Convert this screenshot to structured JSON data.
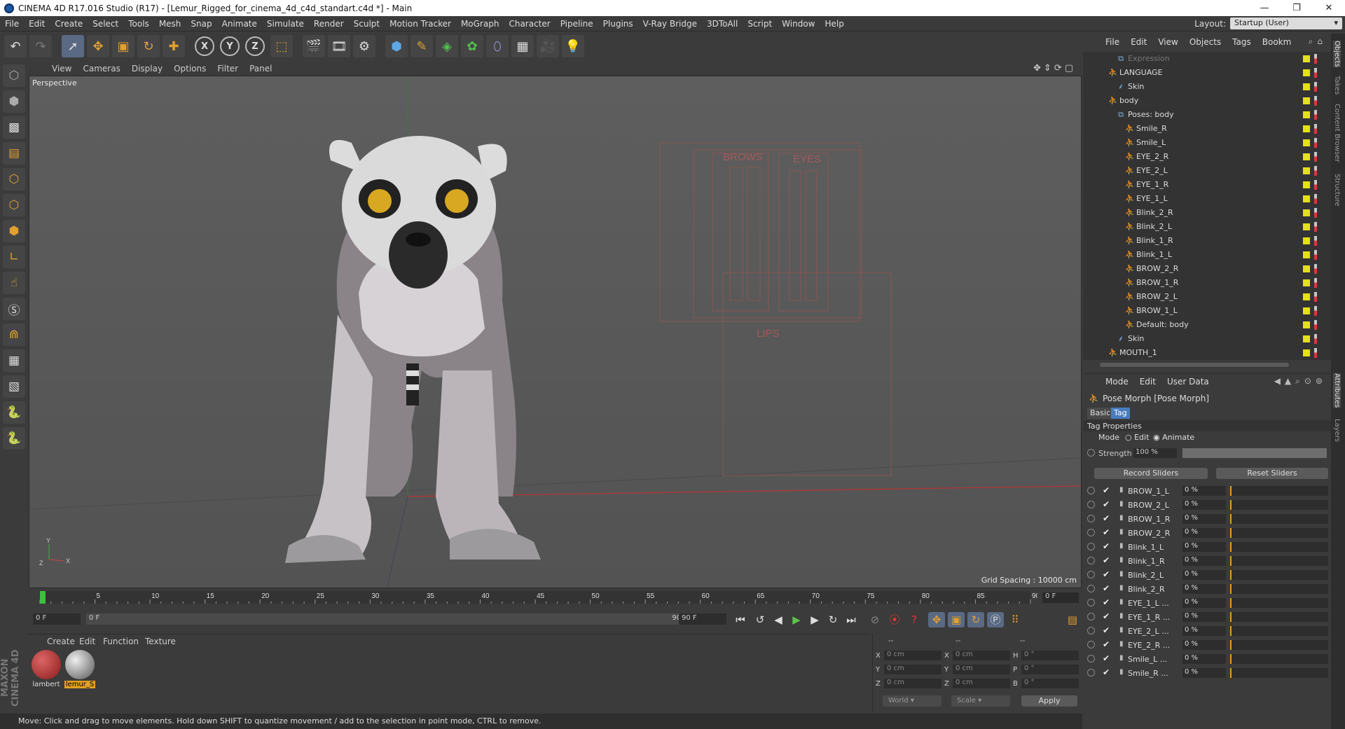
{
  "window": {
    "title": "CINEMA 4D R17.016 Studio (R17) - [Lemur_Rigged_for_cinema_4d_c4d_standart.c4d *] - Main",
    "controls": [
      "—",
      "❐",
      "✕"
    ]
  },
  "menubar": {
    "items": [
      "File",
      "Edit",
      "Create",
      "Select",
      "Tools",
      "Mesh",
      "Snap",
      "Animate",
      "Simulate",
      "Render",
      "Sculpt",
      "Motion Tracker",
      "MoGraph",
      "Character",
      "Pipeline",
      "Plugins",
      "V-Ray Bridge",
      "3DToAll",
      "Script",
      "Window",
      "Help"
    ],
    "layout_label": "Layout:",
    "layout_value": "Startup (User)"
  },
  "toolbar": {
    "icons": [
      "undo-icon",
      "redo-icon",
      "select-icon",
      "move-icon",
      "scale-icon",
      "rotate-icon",
      "add-icon",
      "x-axis-icon",
      "y-axis-icon",
      "z-axis-icon",
      "coordinate-system-icon",
      "render-view-icon",
      "render-picture-queue-icon",
      "render-settings-icon",
      "cube-icon",
      "pen-icon",
      "subdivision-icon",
      "cloner-icon",
      "deformer-icon",
      "floor-icon",
      "camera-icon",
      "light-icon"
    ],
    "axis_labels": [
      "X",
      "Y",
      "Z"
    ]
  },
  "lefttools": {
    "icons": [
      "make-editable-icon",
      "model-mode-icon",
      "texture-mode-icon",
      "workplane-icon",
      "points-mode-icon",
      "edges-mode-icon",
      "polygons-mode-icon",
      "axis-mode-icon",
      "tweak-mode-icon",
      "solo-icon",
      "snap-icon",
      "snap-grid-icon",
      "lock-workplane-icon",
      "python-icon",
      "python-script-icon"
    ],
    "brand": "MAXON CINEMA 4D"
  },
  "viewport": {
    "menu": [
      "View",
      "Cameras",
      "Display",
      "Options",
      "Filter",
      "Panel"
    ],
    "camera_label": "Perspective",
    "grid_spacing": "Grid Spacing : 10000 cm",
    "rig_labels": {
      "brows": "BROWS",
      "eyes": "EYES",
      "lips": "LIPS"
    },
    "axis": {
      "x": "X",
      "y": "Y",
      "z": "Z"
    }
  },
  "timeline": {
    "ticks": [
      "0",
      "5",
      "10",
      "15",
      "20",
      "25",
      "30",
      "35",
      "40",
      "45",
      "50",
      "55",
      "60",
      "65",
      "70",
      "75",
      "80",
      "85",
      "90"
    ],
    "current_frame": "0 F",
    "start_field": "0 F",
    "range_start": "0 F",
    "range_end": "90 F",
    "end_field": "90 F",
    "playhead_frame": 0,
    "max_frame": 90
  },
  "transport": {
    "buttons": [
      "go-to-start-icon",
      "previous-key-icon",
      "previous-frame-icon",
      "play-icon",
      "next-frame-icon",
      "next-key-icon",
      "go-to-end-icon",
      "autokey-icon",
      "record-icon",
      "keyframe-selection-icon",
      "move-key-icon",
      "scale-key-icon",
      "rotate-key-icon",
      "param-key-icon",
      "pla-key-icon",
      "timeline-icon"
    ]
  },
  "material_manager": {
    "menu": [
      "Create",
      "Edit",
      "Function",
      "Texture"
    ],
    "materials": [
      {
        "name": "lambert",
        "selected": false
      },
      {
        "name": "lemur_S",
        "selected": true
      }
    ]
  },
  "coordinates": {
    "header": [
      "--",
      "--",
      "--"
    ],
    "rows": [
      {
        "a": "X",
        "av": "0 cm",
        "b": "X",
        "bv": "0 cm",
        "c": "H",
        "cv": "0 °"
      },
      {
        "a": "Y",
        "av": "0 cm",
        "b": "Y",
        "bv": "0 cm",
        "c": "P",
        "cv": "0 °"
      },
      {
        "a": "Z",
        "av": "0 cm",
        "b": "Z",
        "bv": "0 cm",
        "c": "B",
        "cv": "0 °"
      }
    ],
    "space": "World",
    "mode": "Scale",
    "apply": "Apply"
  },
  "status": "Move: Click and drag to move elements. Hold down SHIFT to quantize movement / add to the selection in point mode, CTRL to remove.",
  "object_manager": {
    "menu": [
      "File",
      "Edit",
      "View",
      "Objects",
      "Tags",
      "Bookm"
    ],
    "items": [
      {
        "name": "Expression",
        "depth": 1,
        "icon": "expression-icon",
        "dim": true
      },
      {
        "name": "LANGUAGE",
        "depth": 0,
        "icon": "joint-icon"
      },
      {
        "name": "Skin",
        "depth": 1,
        "icon": "skin-icon"
      },
      {
        "name": "body",
        "depth": 0,
        "icon": "joint-icon"
      },
      {
        "name": "Poses: body",
        "depth": 1,
        "icon": "pose-icon"
      },
      {
        "name": "Smile_R",
        "depth": 2,
        "icon": "joint-icon"
      },
      {
        "name": "Smile_L",
        "depth": 2,
        "icon": "joint-icon"
      },
      {
        "name": "EYE_2_R",
        "depth": 2,
        "icon": "joint-icon"
      },
      {
        "name": "EYE_2_L",
        "depth": 2,
        "icon": "joint-icon"
      },
      {
        "name": "EYE_1_R",
        "depth": 2,
        "icon": "joint-icon"
      },
      {
        "name": "EYE_1_L",
        "depth": 2,
        "icon": "joint-icon"
      },
      {
        "name": "Blink_2_R",
        "depth": 2,
        "icon": "joint-icon"
      },
      {
        "name": "Blink_2_L",
        "depth": 2,
        "icon": "joint-icon"
      },
      {
        "name": "Blink_1_R",
        "depth": 2,
        "icon": "joint-icon"
      },
      {
        "name": "Blink_1_L",
        "depth": 2,
        "icon": "joint-icon"
      },
      {
        "name": "BROW_2_R",
        "depth": 2,
        "icon": "joint-icon"
      },
      {
        "name": "BROW_1_R",
        "depth": 2,
        "icon": "joint-icon"
      },
      {
        "name": "BROW_2_L",
        "depth": 2,
        "icon": "joint-icon"
      },
      {
        "name": "BROW_1_L",
        "depth": 2,
        "icon": "joint-icon"
      },
      {
        "name": "Default: body",
        "depth": 2,
        "icon": "joint-icon"
      },
      {
        "name": "Skin",
        "depth": 1,
        "icon": "skin-icon"
      },
      {
        "name": "MOUTH_1",
        "depth": 0,
        "icon": "joint-icon"
      }
    ]
  },
  "attributes": {
    "menu": [
      "Mode",
      "Edit",
      "User Data"
    ],
    "title": "Pose Morph [Pose Morph]",
    "tabs": [
      {
        "label": "Basic",
        "active": false
      },
      {
        "label": "Tag",
        "active": true
      }
    ],
    "section": "Tag Properties",
    "mode_label": "Mode",
    "mode_options": [
      "Edit",
      "Animate"
    ],
    "strength_label": "Strength",
    "strength_value": "100 %",
    "strength_level": 1.0,
    "record_sliders": "Record Sliders",
    "reset_sliders": "Reset Sliders",
    "poses": [
      {
        "name": "BROW_1_L",
        "value": "0 %"
      },
      {
        "name": "BROW_2_L",
        "value": "0 %"
      },
      {
        "name": "BROW_1_R",
        "value": "0 %"
      },
      {
        "name": "BROW_2_R",
        "value": "0 %"
      },
      {
        "name": "Blink_1_L",
        "value": "0 %"
      },
      {
        "name": "Blink_1_R",
        "value": "0 %"
      },
      {
        "name": "Blink_2_L",
        "value": "0 %"
      },
      {
        "name": "Blink_2_R",
        "value": "0 %"
      },
      {
        "name": "EYE_1_L ...",
        "value": "0 %"
      },
      {
        "name": "EYE_1_R ...",
        "value": "0 %"
      },
      {
        "name": "EYE_2_L ...",
        "value": "0 %"
      },
      {
        "name": "EYE_2_R ...",
        "value": "0 %"
      },
      {
        "name": "Smile_L ...",
        "value": "0 %"
      },
      {
        "name": "Smile_R ...",
        "value": "0 %"
      }
    ]
  },
  "side_tabs": [
    "Objects",
    "Takes",
    "Content Browser",
    "Structure",
    "Attributes",
    "Layers"
  ],
  "colors": {
    "accent": "#4a7cc0",
    "play": "#5ec24b",
    "record": "#e33333",
    "selected_material": "#e0a020"
  }
}
